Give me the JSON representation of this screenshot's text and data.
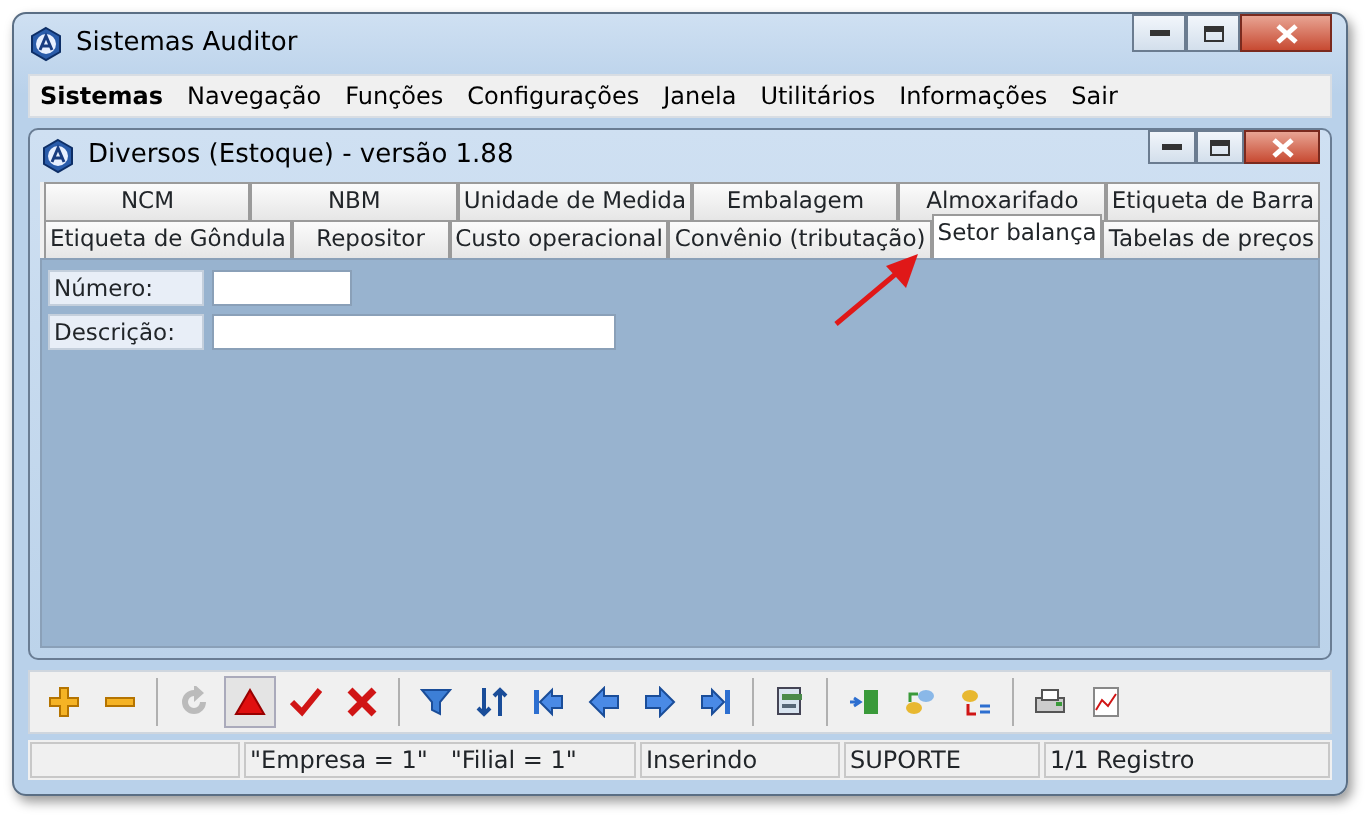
{
  "window": {
    "title": "Sistemas Auditor"
  },
  "menu": [
    {
      "label": "Sistemas",
      "bold": true
    },
    {
      "label": "Navegação",
      "bold": false
    },
    {
      "label": "Funções",
      "bold": false
    },
    {
      "label": "Configurações",
      "bold": false
    },
    {
      "label": "Janela",
      "bold": false
    },
    {
      "label": "Utilitários",
      "bold": false
    },
    {
      "label": "Informações",
      "bold": false
    },
    {
      "label": "Sair",
      "bold": false
    }
  ],
  "child_window": {
    "title": "Diversos (Estoque) - versão 1.88"
  },
  "tab_rows": [
    [
      {
        "label": "NCM",
        "selected": false
      },
      {
        "label": "NBM",
        "selected": false
      },
      {
        "label": "Unidade de Medida",
        "selected": false
      },
      {
        "label": "Embalagem",
        "selected": false
      },
      {
        "label": "Almoxarifado",
        "selected": false
      },
      {
        "label": "Etiqueta de Barra",
        "selected": false
      }
    ],
    [
      {
        "label": "Etiqueta de Gôndula",
        "selected": false
      },
      {
        "label": "Repositor",
        "selected": false
      },
      {
        "label": "Custo operacional",
        "selected": false
      },
      {
        "label": "Convênio (tributação)",
        "selected": false
      },
      {
        "label": "Setor balança",
        "selected": true
      },
      {
        "label": "Tabelas de preços",
        "selected": false
      }
    ]
  ],
  "fields": [
    {
      "label": "Número:",
      "kind": "short"
    },
    {
      "label": "Descrição:",
      "kind": "long"
    }
  ],
  "toolbar": [
    {
      "kind": "plus",
      "disabled": false,
      "pressed": false
    },
    {
      "kind": "minus",
      "disabled": false,
      "pressed": false
    },
    {
      "kind": "sep"
    },
    {
      "kind": "refresh",
      "disabled": true,
      "pressed": false
    },
    {
      "kind": "triangle",
      "disabled": false,
      "pressed": true
    },
    {
      "kind": "check",
      "disabled": false,
      "pressed": false
    },
    {
      "kind": "cross",
      "disabled": false,
      "pressed": false
    },
    {
      "kind": "sep"
    },
    {
      "kind": "filter",
      "disabled": false,
      "pressed": false
    },
    {
      "kind": "sort",
      "disabled": false,
      "pressed": false
    },
    {
      "kind": "first",
      "disabled": false,
      "pressed": false
    },
    {
      "kind": "prev",
      "disabled": false,
      "pressed": false
    },
    {
      "kind": "next",
      "disabled": false,
      "pressed": false
    },
    {
      "kind": "last",
      "disabled": false,
      "pressed": false
    },
    {
      "kind": "sep"
    },
    {
      "kind": "form",
      "disabled": false,
      "pressed": false
    },
    {
      "kind": "sep"
    },
    {
      "kind": "list",
      "disabled": false,
      "pressed": false
    },
    {
      "kind": "db",
      "disabled": false,
      "pressed": false
    },
    {
      "kind": "dbfind",
      "disabled": false,
      "pressed": false
    },
    {
      "kind": "sep"
    },
    {
      "kind": "print",
      "disabled": false,
      "pressed": false
    },
    {
      "kind": "chart",
      "disabled": false,
      "pressed": false
    }
  ],
  "status_bar": [
    "\"Empresa = 1\"   \"Filial = 1\"",
    "Inserindo",
    "SUPORTE",
    "1/1 Registro"
  ]
}
